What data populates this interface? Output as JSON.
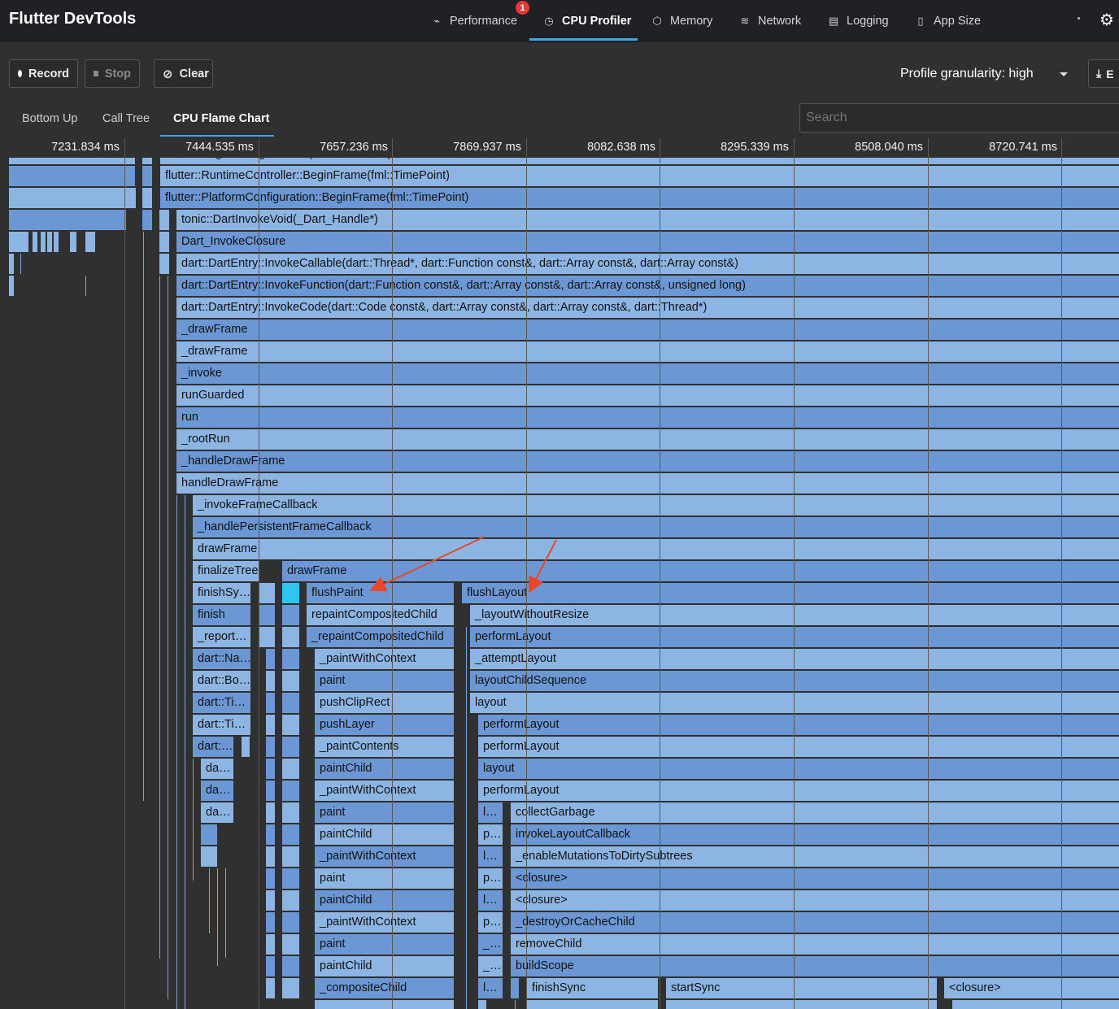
{
  "app": {
    "title": "Flutter DevTools"
  },
  "nav": {
    "tabs": [
      {
        "label": "Performance",
        "icon": "performance-icon"
      },
      {
        "label": "CPU Profiler",
        "icon": "cpu-profiler-icon"
      },
      {
        "label": "Memory",
        "icon": "memory-icon"
      },
      {
        "label": "Network",
        "icon": "network-icon"
      },
      {
        "label": "Logging",
        "icon": "logging-icon"
      },
      {
        "label": "App Size",
        "icon": "app-size-icon"
      }
    ],
    "badge": "1",
    "active": "CPU Profiler"
  },
  "toolbar": {
    "record": "Record",
    "stop": "Stop",
    "clear": "Clear",
    "granularity": "Profile granularity: high",
    "export": "E"
  },
  "subtabs": {
    "items": [
      "Bottom Up",
      "Call Tree",
      "CPU Flame Chart"
    ],
    "active": "CPU Flame Chart"
  },
  "search": {
    "placeholder": "Search"
  },
  "timeline": {
    "ticks": [
      "7231.834 ms",
      "7444.535 ms",
      "7657.236 ms",
      "7869.937 ms",
      "8082.638 ms",
      "8295.339 ms",
      "8508.040 ms",
      "8720.741 ms"
    ]
  },
  "flame": {
    "rows": [
      {
        "label": "flutter::Engine::BeginFrame(fml::TimePoint)"
      },
      {
        "label": "flutter::RuntimeController::BeginFrame(fml::TimePoint)"
      },
      {
        "label": "flutter::PlatformConfiguration::BeginFrame(fml::TimePoint)"
      },
      {
        "label": "tonic::DartInvokeVoid(_Dart_Handle*)"
      },
      {
        "label": "Dart_InvokeClosure"
      },
      {
        "label": "dart::DartEntry::InvokeCallable(dart::Thread*, dart::Function const&, dart::Array const&, dart::Array const&)"
      },
      {
        "label": "dart::DartEntry::InvokeFunction(dart::Function const&, dart::Array const&, dart::Array const&, unsigned long)"
      },
      {
        "label": "dart::DartEntry::InvokeCode(dart::Code const&, dart::Array const&, dart::Array const&, dart::Thread*)"
      },
      {
        "label": "_drawFrame"
      },
      {
        "label": "_drawFrame"
      },
      {
        "label": "_invoke"
      },
      {
        "label": "runGuarded"
      },
      {
        "label": "run"
      },
      {
        "label": "_rootRun"
      },
      {
        "label": "_handleDrawFrame"
      },
      {
        "label": "handleDrawFrame"
      },
      {
        "label": "_invokeFrameCallback"
      },
      {
        "label": "_handlePersistentFrameCallback"
      },
      {
        "label": "drawFrame"
      }
    ],
    "left_column": [
      "finalizeTree",
      "finishSy…",
      "finish",
      "_report…",
      "dart::Na…",
      "dart::Bo…",
      "dart::Ti…",
      "dart::Ti…",
      "dart:…",
      "da…",
      "da…",
      "da…"
    ],
    "draw_frame_2": "drawFrame",
    "paint_column": [
      "flushPaint",
      "repaintCompositedChild",
      "_repaintCompositedChild",
      "_paintWithContext",
      "paint",
      "pushClipRect",
      "pushLayer",
      "_paintContents",
      "paintChild",
      "_paintWithContext",
      "paint",
      "paintChild",
      "_paintWithContext",
      "paint",
      "paintChild",
      "_paintWithContext",
      "paint",
      "paintChild",
      "_compositeChild"
    ],
    "layout_column": [
      "flushLayout",
      "_layoutWithoutResize",
      "performLayout",
      "_attemptLayout",
      "layoutChildSequence",
      "layout",
      "performLayout",
      "performLayout",
      "layout",
      "performLayout"
    ],
    "narrow_column": [
      "l…",
      "p…",
      "l…",
      "p…",
      "l…",
      "p…",
      "_…",
      "_…",
      "l…"
    ],
    "right_column": [
      "collectGarbage",
      "invokeLayoutCallback",
      "_enableMutationsToDirtySubtrees",
      "<closure>",
      "<closure>",
      "_destroyOrCacheChild",
      "removeChild",
      "buildScope"
    ],
    "bottom_row": [
      "finishSync",
      "startSync",
      "<closure>"
    ]
  }
}
